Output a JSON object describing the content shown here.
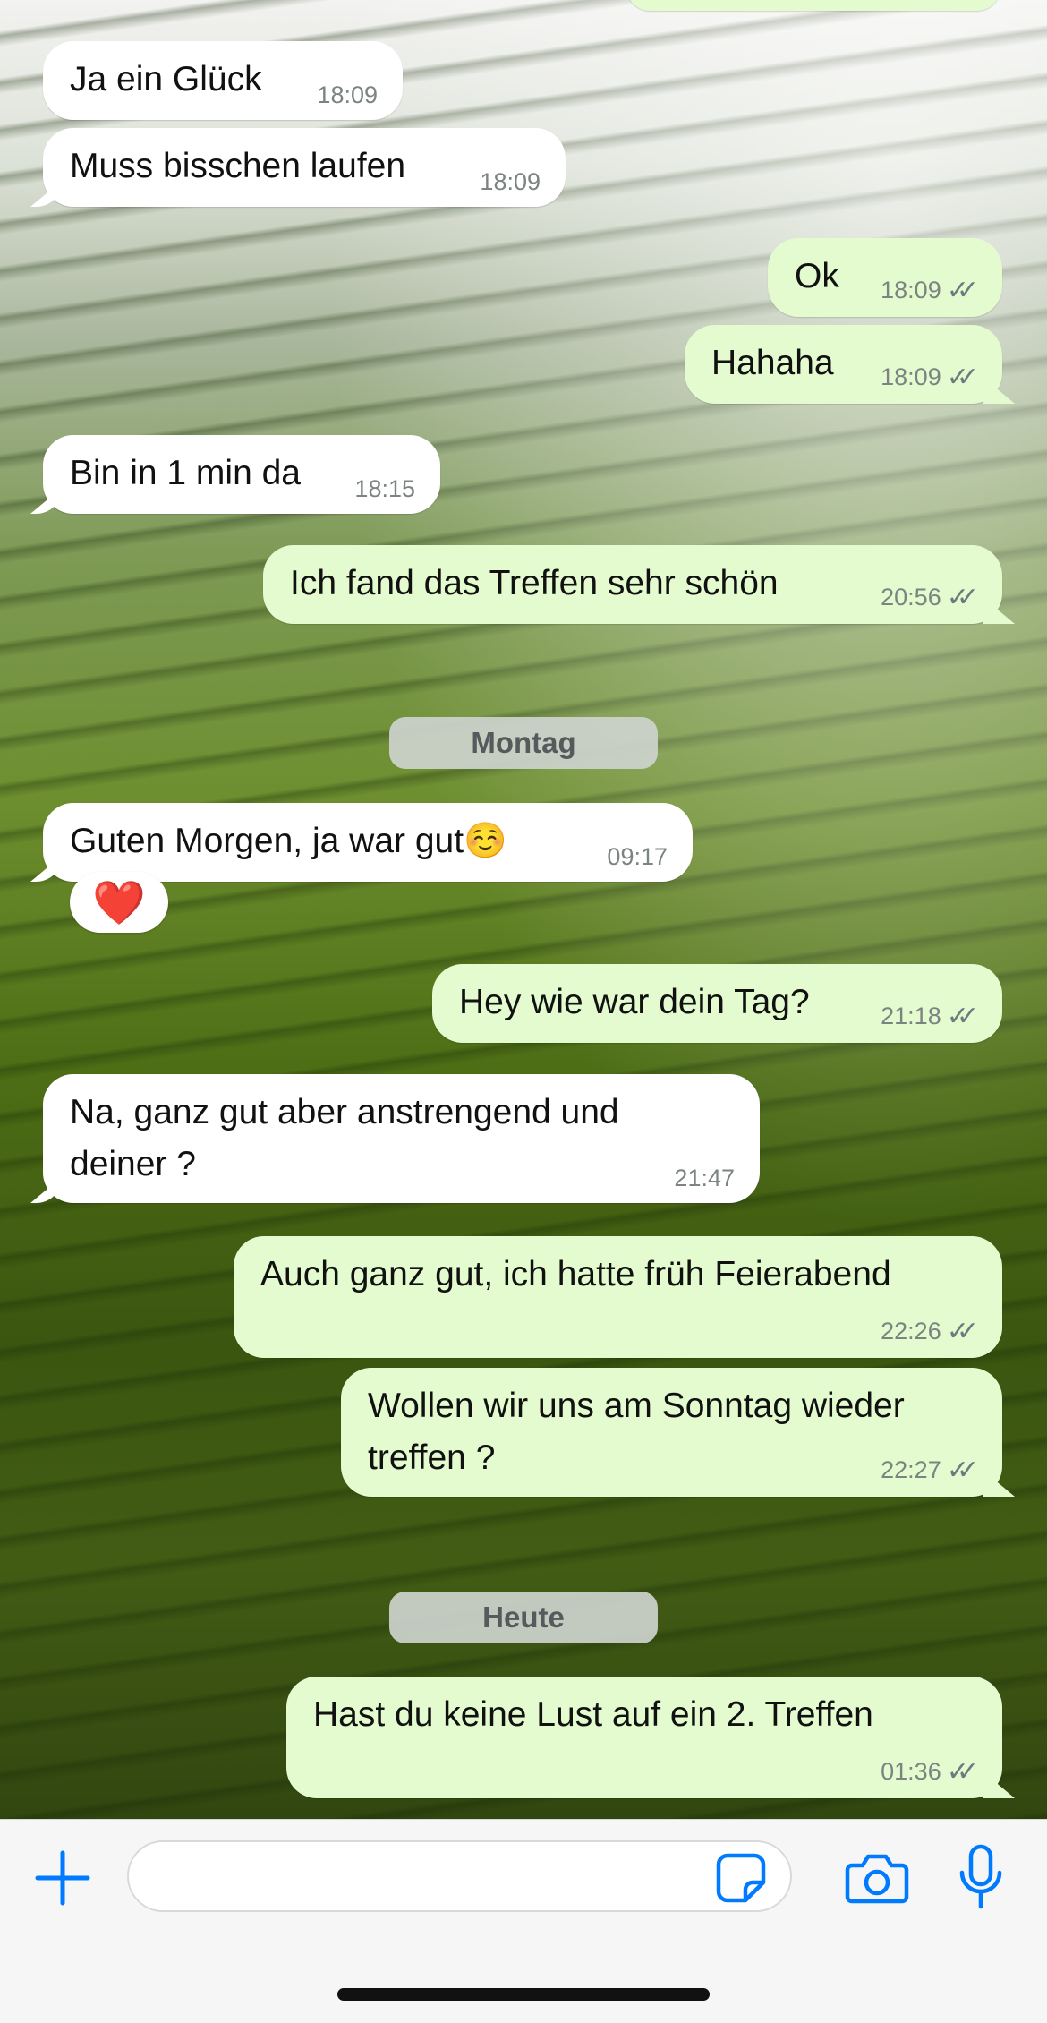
{
  "colors": {
    "accent": "#007aff",
    "incoming_bubble": "#ffffff",
    "outgoing_bubble": "#e3fbcf"
  },
  "messages": [
    {
      "dir": "in",
      "text": "Ja ein Glück",
      "time": "18:09"
    },
    {
      "dir": "in",
      "text": "Muss bisschen laufen",
      "time": "18:09"
    },
    {
      "dir": "out",
      "text": "Ok",
      "time": "18:09"
    },
    {
      "dir": "out",
      "text": "Hahaha",
      "time": "18:09"
    },
    {
      "dir": "in",
      "text": "Bin in 1 min da",
      "time": "18:15"
    },
    {
      "dir": "out",
      "text": "Ich fand das Treffen sehr schön",
      "time": "20:56"
    },
    {
      "dir": "in",
      "text": "Guten Morgen, ja war gut☺️",
      "time": "09:17",
      "reaction": "❤️"
    },
    {
      "dir": "out",
      "text": "Hey wie war dein Tag?",
      "time": "21:18"
    },
    {
      "dir": "in",
      "text": "Na, ganz gut aber anstrengend und\ndeiner ?",
      "time": "21:47"
    },
    {
      "dir": "out",
      "text": "Auch ganz gut, ich hatte früh Feierabend",
      "time": "22:26"
    },
    {
      "dir": "out",
      "text": "Wollen wir uns am Sonntag wieder\ntreffen ?",
      "time": "22:27"
    },
    {
      "dir": "out",
      "text": "Hast du keine Lust auf ein 2. Treffen",
      "time": "01:36"
    }
  ],
  "day_separators": [
    "Montag",
    "Heute"
  ],
  "read_ticks": "✓✓",
  "input": {
    "placeholder": ""
  },
  "icons": [
    "plus-icon",
    "sticker-icon",
    "camera-icon",
    "microphone-icon"
  ]
}
